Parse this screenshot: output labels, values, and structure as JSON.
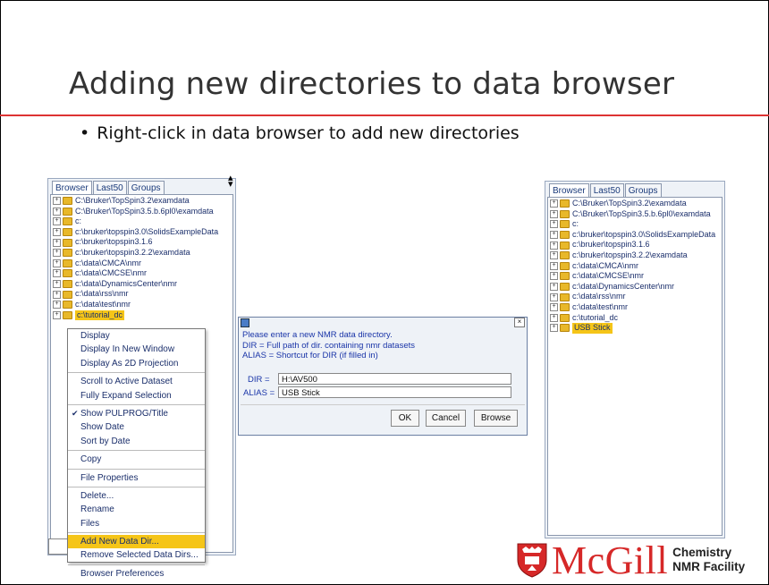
{
  "slide": {
    "title": "Adding new directories to data browser",
    "bullet": "Right-click in data browser to add new directories"
  },
  "tabs": [
    "Browser",
    "Last50",
    "Groups"
  ],
  "left_tree": [
    "C:\\Bruker\\TopSpin3.2\\examdata",
    "C:\\Bruker\\TopSpin3.5.b.6pl0\\examdata",
    "c:",
    "c:\\bruker\\topspin3.0\\SolidsExampleData",
    "c:\\bruker\\topspin3.1.6",
    "c:\\bruker\\topspin3.2.2\\examdata",
    "c:\\data\\CMCA\\nmr",
    "c:\\data\\CMCSE\\nmr",
    "c:\\data\\DynamicsCenter\\nmr",
    "c:\\data\\rss\\nmr",
    "c:\\data\\test\\nmr",
    "c:\\tutorial_dc"
  ],
  "right_tree": [
    "C:\\Bruker\\TopSpin3.2\\examdata",
    "C:\\Bruker\\TopSpin3.5.b.6pl0\\examdata",
    "c:",
    "c:\\bruker\\topspin3.0\\SolidsExampleData",
    "c:\\bruker\\topspin3.1.6",
    "c:\\bruker\\topspin3.2.2\\examdata",
    "c:\\data\\CMCA\\nmr",
    "c:\\data\\CMCSE\\nmr",
    "c:\\data\\DynamicsCenter\\nmr",
    "c:\\data\\rss\\nmr",
    "c:\\data\\test\\nmr",
    "c:\\tutorial_dc",
    "USB Stick"
  ],
  "context_menu": {
    "groups": [
      [
        "Display",
        "Display In New Window",
        "Display As 2D Projection"
      ],
      [
        "Scroll to Active Dataset",
        "Fully Expand Selection"
      ],
      [
        "Show PULPROG/Title",
        "Show Date",
        "Sort by Date"
      ],
      [
        "Copy"
      ],
      [
        "File Properties"
      ],
      [
        "Delete...",
        "Rename",
        "Files"
      ],
      [
        "Add New Data Dir...",
        "Remove Selected Data Dirs..."
      ],
      [
        "Browser Preferences"
      ]
    ],
    "checked_item": "Show PULPROG/Title",
    "highlighted_item": "Add New Data Dir..."
  },
  "dialog": {
    "close_glyph": "×",
    "message_lines": [
      "Please enter a new NMR data directory.",
      "DIR = Full path of dir. containing nmr datasets",
      "ALIAS = Shortcut for DIR (if filled in)"
    ],
    "dir_label": "DIR =",
    "dir_value": "H:\\AV500",
    "alias_label": "ALIAS =",
    "alias_value": "USB Stick",
    "buttons": [
      "OK",
      "Cancel",
      "Browse"
    ]
  },
  "logo": {
    "name": "McGill",
    "line1": "Chemistry",
    "line2": "NMR Facility"
  },
  "colors": {
    "accent_red": "#d33333",
    "highlight_yellow": "#f5c518",
    "tree_text": "#1b2f6b",
    "dialog_text": "#1a35a8"
  }
}
